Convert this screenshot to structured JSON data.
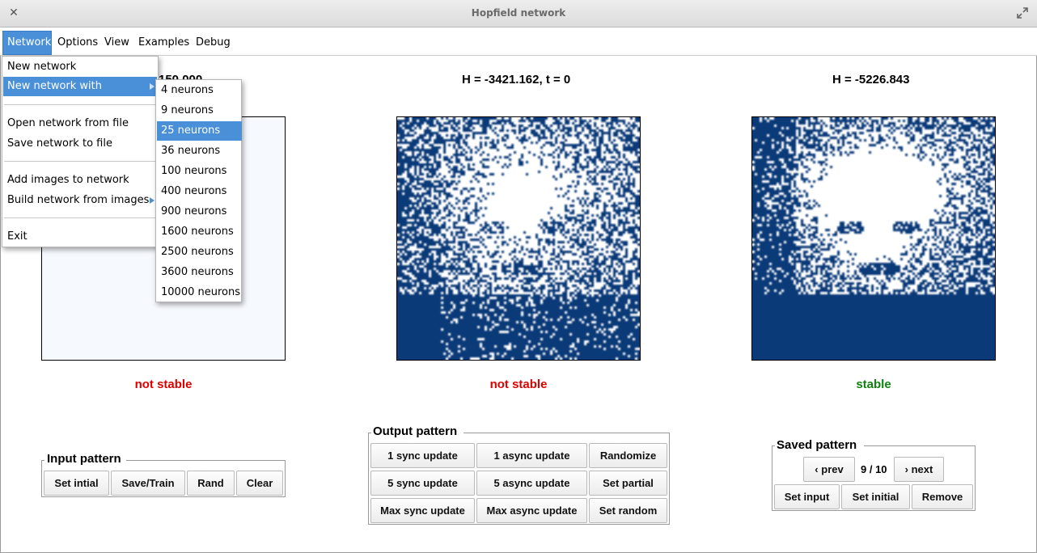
{
  "window": {
    "title": "Hopfield network"
  },
  "menubar": {
    "items": [
      "Network",
      "Options",
      "View",
      "Examples",
      "Debug"
    ]
  },
  "network_menu": {
    "items": [
      "New network",
      "New network with",
      "Open network from file",
      "Save network to file",
      "Add images to network",
      "Build network from images",
      "Exit"
    ]
  },
  "neurons_submenu": {
    "items": [
      "4 neurons",
      "9 neurons",
      "25 neurons",
      "36 neurons",
      "100 neurons",
      "400 neurons",
      "900 neurons",
      "1600 neurons",
      "2500 neurons",
      "3600 neurons",
      "10000 neurons"
    ],
    "selected": "25 neurons"
  },
  "panels": {
    "input": {
      "energy_partial": "150.000",
      "status": "not stable"
    },
    "output": {
      "energy": "H = -3421.162, t = 0",
      "status": "not stable"
    },
    "saved": {
      "energy": "H = -5226.843",
      "status": "stable"
    }
  },
  "input_group": {
    "label": "Input pattern",
    "buttons": [
      "Set intial",
      "Save/Train",
      "Rand",
      "Clear"
    ]
  },
  "output_group": {
    "label": "Output pattern",
    "buttons": [
      "1 sync update",
      "1 async update",
      "Randomize",
      "5 sync update",
      "5 async update",
      "Set partial",
      "Max sync update",
      "Max async update",
      "Set random"
    ]
  },
  "saved_group": {
    "label": "Saved pattern",
    "prev": "prev",
    "next": "next",
    "counter": "9 / 10",
    "buttons": [
      "Set input",
      "Set initial",
      "Remove"
    ]
  },
  "colors": {
    "pattern_dark": "#0b3a78",
    "pattern_light": "#ffffff",
    "input_bg": "#f6f9fe",
    "stable": "#108010",
    "not_stable": "#e00000",
    "highlight": "#4a90d9"
  }
}
